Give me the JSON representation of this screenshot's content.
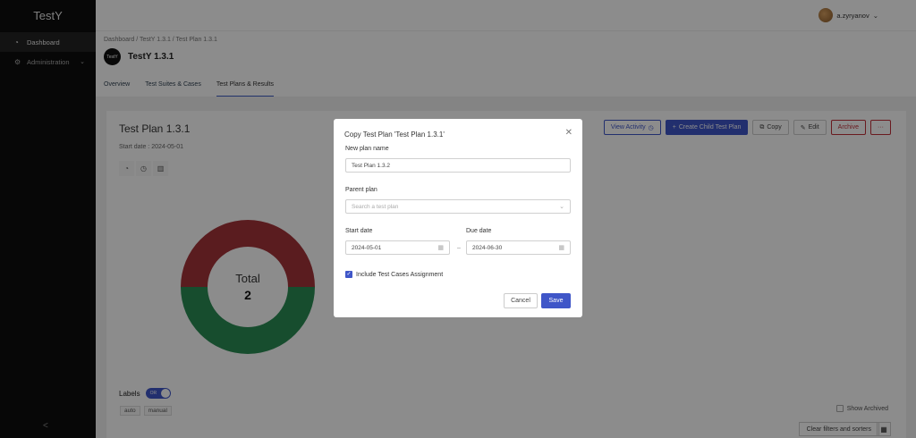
{
  "app": {
    "title": "TestY"
  },
  "sidebar": {
    "items": [
      {
        "label": "Dashboard",
        "icon": "dashboard-icon"
      },
      {
        "label": "Administration",
        "icon": "gear-icon"
      }
    ],
    "collapse_glyph": "<"
  },
  "user": {
    "name": "a.zyryanov"
  },
  "breadcrumb": {
    "text": "Dashboard / TestY 1.3.1 / Test Plan 1.3.1"
  },
  "project": {
    "logo_text": "TestY",
    "title": "TestY 1.3.1"
  },
  "tabs": [
    {
      "label": "Overview"
    },
    {
      "label": "Test Suites & Cases"
    },
    {
      "label": "Test Plans & Results"
    }
  ],
  "plan": {
    "title": "Test Plan 1.3.1",
    "start_label": "Start date :",
    "start_value": "2024-05-01"
  },
  "toolbar": {
    "view_activity": "View Activity",
    "create_child": "Create Child Test Plan",
    "copy": "Copy",
    "edit": "Edit",
    "archive": "Archive",
    "more": "···"
  },
  "chart_data": {
    "type": "pie",
    "center_label": "Total",
    "total": 2,
    "slices": [
      {
        "value": 1,
        "color": "#a4343a"
      },
      {
        "value": 1,
        "color": "#2a8c55"
      }
    ]
  },
  "labels_section": {
    "label": "Labels",
    "toggle_text": "OR",
    "chips": [
      "auto",
      "manual"
    ]
  },
  "show_archived": "Show Archived",
  "clear_filters": "Clear filters and sorters",
  "modal": {
    "title": "Copy Test Plan 'Test Plan 1.3.1'",
    "new_plan_label": "New plan name",
    "new_plan_value": "Test Plan 1.3.2",
    "parent_label": "Parent plan",
    "parent_placeholder": "Search a test plan",
    "start_label": "Start date",
    "start_value": "2024-05-01",
    "due_label": "Due date",
    "due_value": "2024-06-30",
    "include_label": "Include Test Cases Assignment",
    "cancel": "Cancel",
    "save": "Save"
  },
  "colors": {
    "accent": "#3f56c8",
    "danger": "#c0303a",
    "sidebar_bg": "#0d0d0d"
  }
}
